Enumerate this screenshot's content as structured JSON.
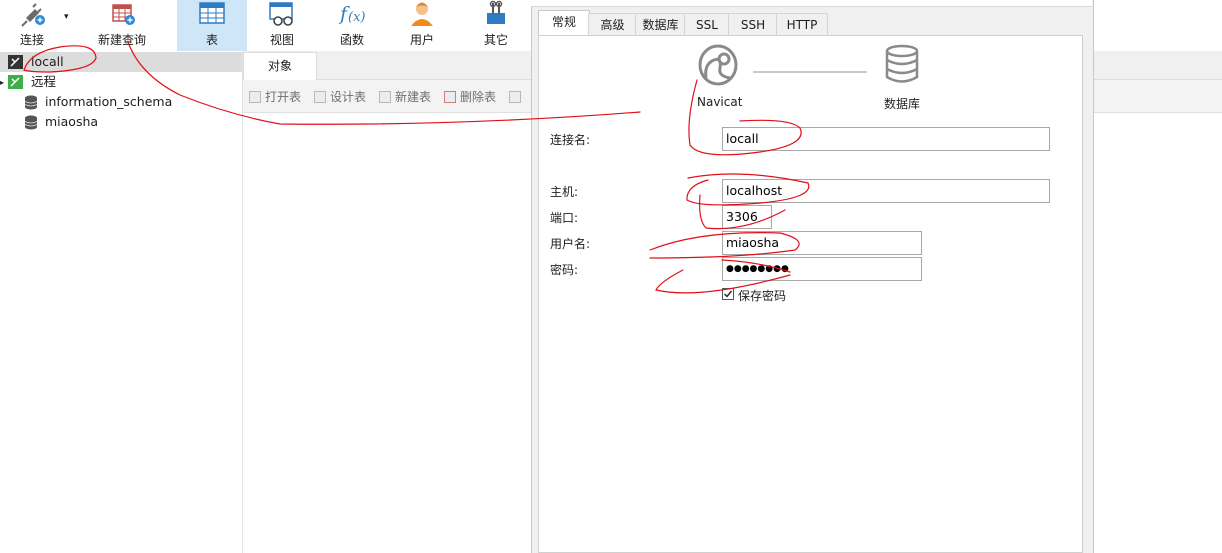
{
  "toolbar": {
    "connect": "连接",
    "new_query": "新建查询",
    "table": "表",
    "view": "视图",
    "function": "函数",
    "user": "用户",
    "other": "其它"
  },
  "sidebar": {
    "items": [
      {
        "label": "locall",
        "icon": "connection-icon",
        "selected": true
      },
      {
        "label": "远程",
        "icon": "remote-connection-icon"
      },
      {
        "label": "information_schema",
        "icon": "database-icon"
      },
      {
        "label": "miaosha",
        "icon": "database-icon"
      }
    ]
  },
  "main": {
    "tab": "对象",
    "actions": [
      "打开表",
      "设计表",
      "新建表",
      "删除表"
    ]
  },
  "dialog": {
    "tabs": [
      "常规",
      "高级",
      "数据库",
      "SSL",
      "SSH",
      "HTTP"
    ],
    "active_tab": "常规",
    "diagram": {
      "left": "Navicat",
      "right": "数据库"
    },
    "fields": {
      "conn_name_label": "连接名:",
      "conn_name": "locall",
      "host_label": "主机:",
      "host": "localhost",
      "port_label": "端口:",
      "port": "3306",
      "user_label": "用户名:",
      "user": "miaosha",
      "password_label": "密码:",
      "password": "●●●●●●●●",
      "save_password": "保存密码"
    }
  },
  "colors": {
    "annotation": "#e0101a",
    "active_tool": "#cfe5f8",
    "selected_row": "#dcdcdc"
  }
}
